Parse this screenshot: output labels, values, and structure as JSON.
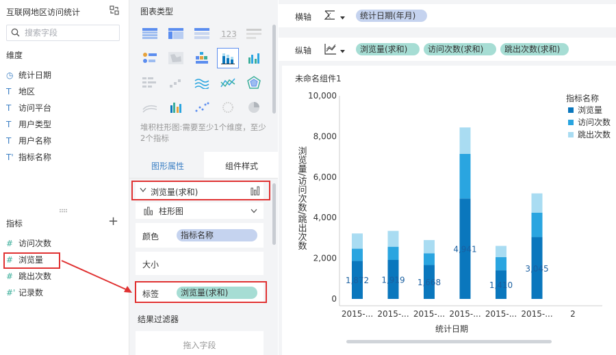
{
  "left": {
    "title": "互联网地区访问统计",
    "search": {
      "placeholder": "搜索字段"
    },
    "dimensions_label": "维度",
    "dimensions": [
      {
        "icon": "clock-icon",
        "glyph": "◷",
        "label": "统计日期"
      },
      {
        "icon": "text-icon",
        "glyph": "T",
        "label": "地区"
      },
      {
        "icon": "text-icon",
        "glyph": "T",
        "label": "访问平台"
      },
      {
        "icon": "text-icon",
        "glyph": "T",
        "label": "用户类型"
      },
      {
        "icon": "text-icon",
        "glyph": "T",
        "label": "用户名称"
      },
      {
        "icon": "text-calc-icon",
        "glyph": "T'",
        "label": "指标名称"
      }
    ],
    "metrics_label": "指标",
    "add_label": "+",
    "metrics": [
      {
        "icon": "hash-icon",
        "glyph": "#",
        "label": "访问次数"
      },
      {
        "icon": "hash-icon",
        "glyph": "#",
        "label": "浏览量"
      },
      {
        "icon": "hash-icon",
        "glyph": "#",
        "label": "跳出次数"
      },
      {
        "icon": "hash-calc-icon",
        "glyph": "#'",
        "label": "记录数"
      }
    ]
  },
  "middle": {
    "chart_types_title": "图表类型",
    "hint": "堆积柱形图:需要至少1个维度，至少2个指标",
    "tabs": [
      "图形属性",
      "组件样式"
    ],
    "measure_header": "浏览量(求和)",
    "chart_type_select": "柱形图",
    "color_label": "颜色",
    "color_value": "指标名称",
    "size_label": "大小",
    "label_label": "标签",
    "label_value": "浏览量(求和)",
    "filter_title": "结果过滤器",
    "filter_placeholder": "拖入字段"
  },
  "right": {
    "x_axis_label": "横轴",
    "x_axis_fields": [
      "统计日期(年月)"
    ],
    "y_axis_label": "纵轴",
    "y_axis_fields": [
      "浏览量(求和)",
      "访问次数(求和)",
      "跳出次数(求和)"
    ],
    "component_title": "未命名组件1"
  },
  "colors": {
    "accent": "#3b7fc4",
    "highlight": "#e03131",
    "series1": "#0a77bd",
    "series2": "#2aa5e0",
    "series3": "#a9dcf2"
  },
  "chart_data": {
    "type": "bar",
    "stacked": true,
    "categories": [
      "2015-...",
      "2015-...",
      "2015-...",
      "2015-...",
      "2015-...",
      "2015-...",
      "2"
    ],
    "xlabel": "统计日期",
    "ylabel": "浏览量/访问次数/跳出次数",
    "ylim": [
      0,
      10000
    ],
    "yticks": [
      "0",
      "2,000",
      "4,000",
      "6,000",
      "8,000",
      "10,000"
    ],
    "legend_title": "指标名称",
    "legend_position": "right",
    "series": [
      {
        "name": "浏览量",
        "values": [
          1872,
          1919,
          1668,
          4941,
          1410,
          3045
        ],
        "labels": [
          "1,872",
          "1,919",
          "1,668",
          "4,941",
          "1,410",
          "3,045"
        ]
      },
      {
        "name": "访问次数",
        "values": [
          600,
          650,
          580,
          2200,
          650,
          1200
        ]
      },
      {
        "name": "跳出次数",
        "values": [
          750,
          780,
          650,
          1300,
          550,
          950
        ]
      }
    ]
  }
}
